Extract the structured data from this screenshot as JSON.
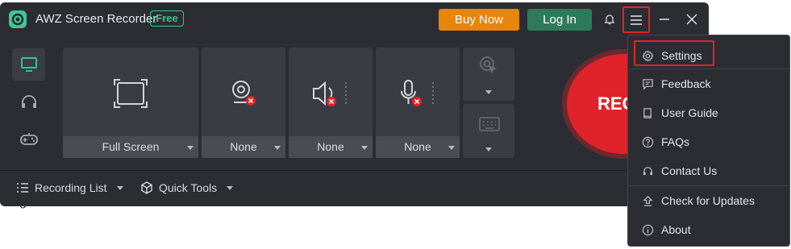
{
  "background_text": "g",
  "app": {
    "title": "AWZ Screen Recorder",
    "badge": "Free",
    "buy_label": "Buy Now",
    "login_label": "Log In"
  },
  "sidebar": {
    "items": [
      {
        "icon": "monitor-icon",
        "active": true
      },
      {
        "icon": "headphones-icon",
        "active": false
      },
      {
        "icon": "gamepad-icon",
        "active": false
      }
    ]
  },
  "sources": {
    "screen": "Full Screen",
    "webcam": "None",
    "system_audio": "None",
    "microphone": "None"
  },
  "record_label": "REC",
  "bottom": {
    "recording_list": "Recording List",
    "quick_tools": "Quick Tools"
  },
  "menu": {
    "items": [
      {
        "label": "Settings",
        "icon": "gear-icon"
      },
      {
        "label": "Feedback",
        "icon": "feedback-icon"
      },
      {
        "label": "User Guide",
        "icon": "book-icon"
      },
      {
        "label": "FAQs",
        "icon": "question-icon"
      },
      {
        "label": "Contact Us",
        "icon": "headset-icon"
      },
      {
        "label": "Check for Updates",
        "icon": "update-icon"
      },
      {
        "label": "About",
        "icon": "info-icon"
      }
    ]
  },
  "colors": {
    "accent_green": "#36c38d",
    "buy_orange": "#e7850d",
    "record_red": "#e0232b",
    "highlight_red": "#e32424"
  }
}
